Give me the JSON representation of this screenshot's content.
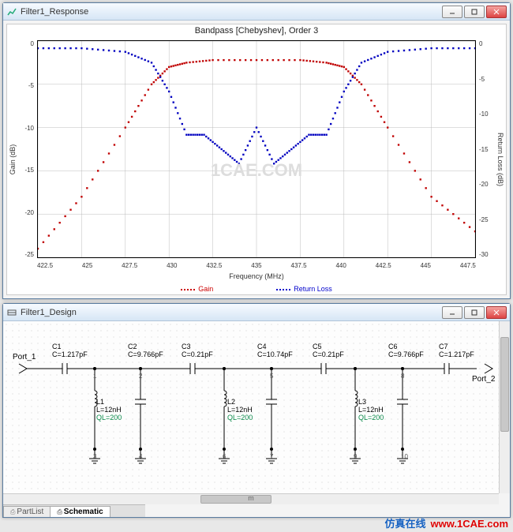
{
  "windows": {
    "response": {
      "title": "Filter1_Response",
      "chart_title": "Bandpass [Chebyshev], Order 3",
      "xlabel": "Frequency (MHz)",
      "ylabel_left": "Gain (dB)",
      "ylabel_right": "Return Loss (dB)",
      "legend": {
        "gain": "Gain",
        "return_loss": "Return Loss"
      },
      "watermark": "1CAE.COM"
    },
    "design": {
      "title": "Filter1_Design",
      "tabs": {
        "partlist": "PartList",
        "schematic": "Schematic"
      },
      "hscroll_label": "m",
      "ports": {
        "p1": "Port_1",
        "p2": "Port_2"
      },
      "components": {
        "C1": {
          "name": "C1",
          "val": "C=1.217pF"
        },
        "C2": {
          "name": "C2",
          "val": "C=9.766pF"
        },
        "C3": {
          "name": "C3",
          "val": "C=0.21pF"
        },
        "C4": {
          "name": "C4",
          "val": "C=10.74pF"
        },
        "C5": {
          "name": "C5",
          "val": "C=0.21pF"
        },
        "C6": {
          "name": "C6",
          "val": "C=9.766pF"
        },
        "C7": {
          "name": "C7",
          "val": "C=1.217pF"
        },
        "L1": {
          "name": "L1",
          "val": "L=12nH",
          "q": "QL=200"
        },
        "L2": {
          "name": "L2",
          "val": "L=12nH",
          "q": "QL=200"
        },
        "L3": {
          "name": "L3",
          "val": "L=12nH",
          "q": "QL=200"
        }
      },
      "watermark_faint": "www."
    }
  },
  "chart_data": {
    "type": "line",
    "xlabel": "Frequency (MHz)",
    "x_ticks": [
      422.5,
      425,
      427.5,
      430,
      432.5,
      435,
      437.5,
      440,
      442.5,
      445,
      447.5
    ],
    "y_ticks_left": [
      0,
      -5,
      -10,
      -15,
      -20,
      -25
    ],
    "y_ticks_right": [
      0,
      -5,
      -10,
      -15,
      -20,
      -25,
      -30
    ],
    "xlim": [
      422.5,
      447.5
    ],
    "ylim_left": [
      -25,
      0
    ],
    "ylim_right": [
      -30,
      0
    ],
    "series": [
      {
        "name": "Gain",
        "color": "#c00000",
        "style": "dotted",
        "y_axis": "left",
        "x": [
          422.5,
          425,
          427.5,
          429,
          430,
          431,
          432.5,
          435,
          437.5,
          439,
          440,
          441,
          442.5,
          445,
          447.5
        ],
        "values": [
          -24,
          -18,
          -10,
          -5,
          -3,
          -2.5,
          -2.2,
          -2.2,
          -2.2,
          -2.5,
          -3,
          -5,
          -10,
          -18,
          -22
        ]
      },
      {
        "name": "Return Loss",
        "color": "#0000c0",
        "style": "dotted",
        "y_axis": "right",
        "x": [
          422.5,
          425,
          427.5,
          429,
          430,
          431,
          432,
          433,
          434,
          435,
          436,
          437,
          438,
          439,
          440,
          441,
          442.5,
          445,
          447.5
        ],
        "values": [
          -1,
          -1,
          -1.5,
          -3,
          -7,
          -13,
          -13,
          -15,
          -17,
          -12,
          -17,
          -15,
          -13,
          -13,
          -7,
          -3,
          -1.5,
          -1,
          -1
        ]
      }
    ]
  },
  "branding": {
    "cn": "仿真在线",
    "url": "www.1CAE.com"
  }
}
